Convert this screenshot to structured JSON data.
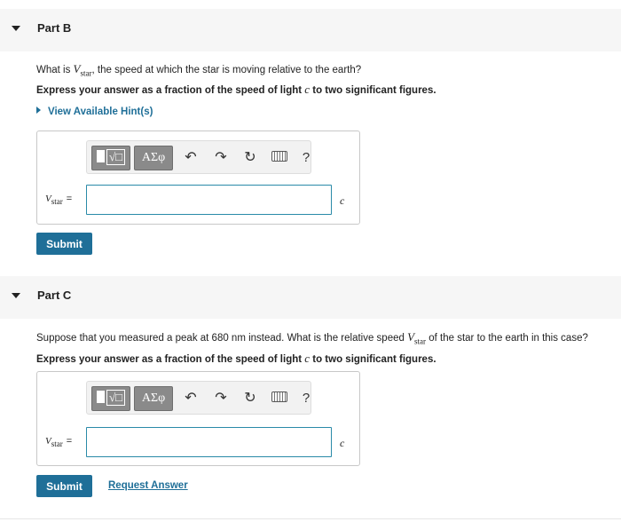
{
  "partB": {
    "title": "Part B",
    "question_pre": "What is ",
    "question_var": "V",
    "question_sub": "star",
    "question_post": ", the speed at which the star is moving relative to the earth?",
    "instruction_pre": "Express your answer as a fraction of the speed of light ",
    "instruction_var": "c",
    "instruction_post": " to two significant figures.",
    "hint_label": "View Available Hint(s)",
    "toolbar": {
      "template_icon": "√□",
      "greek_label": "ΑΣφ",
      "undo_icon": "undo-icon",
      "redo_icon": "redo-icon",
      "reset_icon": "reset-icon",
      "keyboard_icon": "keyboard-icon",
      "help_label": "?"
    },
    "answer_label_var": "V",
    "answer_label_sub": "star",
    "answer_label_eq": "=",
    "answer_value": "",
    "unit": "c",
    "submit_label": "Submit"
  },
  "partC": {
    "title": "Part C",
    "question_pre": "Suppose that you measured a peak at 680 nm instead. What is the relative speed ",
    "question_var": "V",
    "question_sub": "star",
    "question_post": " of the star to the earth in this case?",
    "instruction_pre": "Express your answer as a fraction of the speed of light ",
    "instruction_var": "c",
    "instruction_post": " to two significant figures.",
    "toolbar": {
      "template_icon": "√□",
      "greek_label": "ΑΣφ",
      "undo_icon": "undo-icon",
      "redo_icon": "redo-icon",
      "reset_icon": "reset-icon",
      "keyboard_icon": "keyboard-icon",
      "help_label": "?"
    },
    "answer_label_var": "V",
    "answer_label_sub": "star",
    "answer_label_eq": "=",
    "answer_value": "",
    "unit": "c",
    "submit_label": "Submit",
    "request_answer_label": "Request Answer"
  },
  "colors": {
    "accent": "#1f6f98",
    "input_border": "#2a8aa8",
    "header_bg": "#f6f6f6",
    "toolbar_btn": "#8a8a8a"
  }
}
